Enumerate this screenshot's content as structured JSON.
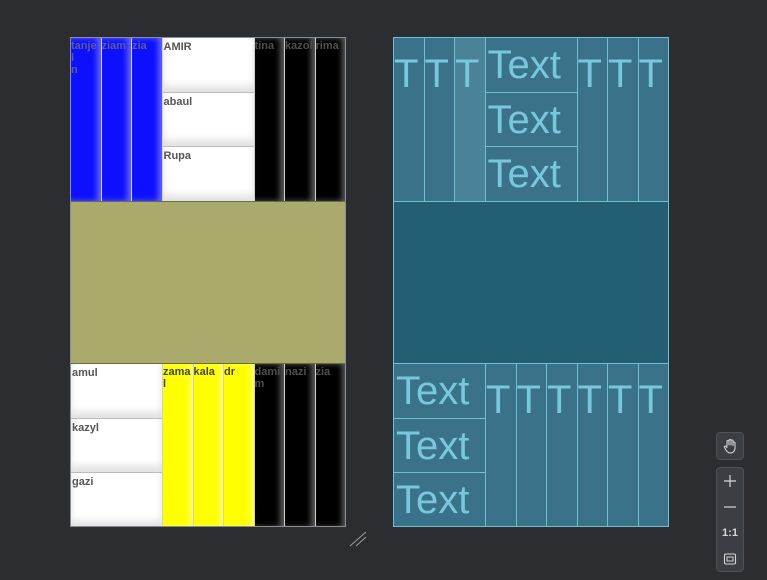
{
  "design": {
    "top_band": {
      "left_columns": [
        {
          "label": "tanjel\nn",
          "color": "blue"
        },
        {
          "label": "ziam",
          "color": "blue"
        },
        {
          "label": "zia",
          "color": "blue"
        }
      ],
      "stack_cells": [
        "AMIR",
        "abaul",
        "Rupa"
      ],
      "right_columns": [
        {
          "label": "tina",
          "color": "black"
        },
        {
          "label": "kazol",
          "color": "black"
        },
        {
          "label": "rima",
          "color": "black"
        }
      ]
    },
    "middle_color": "#aaaa6c",
    "bottom_band": {
      "stack_cells": [
        "amul",
        "kazyl",
        "gazi"
      ],
      "left_columns": [
        {
          "label": "zama\nl",
          "color": "yellow"
        },
        {
          "label": "kala",
          "color": "yellow"
        },
        {
          "label": "dr",
          "color": "yellow"
        }
      ],
      "right_columns": [
        {
          "label": "dami\nm",
          "color": "black"
        },
        {
          "label": "nazi",
          "color": "black"
        },
        {
          "label": "zia",
          "color": "black"
        }
      ]
    }
  },
  "blueprint": {
    "column_glyph": "T",
    "cell_text": "Text"
  },
  "toolbar": {
    "pan_icon": "hand-icon",
    "zoom_in_icon": "plus-icon",
    "zoom_out_icon": "minus-icon",
    "actual_size_label": "1:1",
    "fit_icon": "fit-screen-icon"
  },
  "colors": {
    "background": "#2b2d30",
    "blue": "#0c10ff",
    "yellow": "#ffff00",
    "olive": "#aaaa6c",
    "blueprint": "#275f74",
    "blueprint_line": "#6fbfd6"
  }
}
